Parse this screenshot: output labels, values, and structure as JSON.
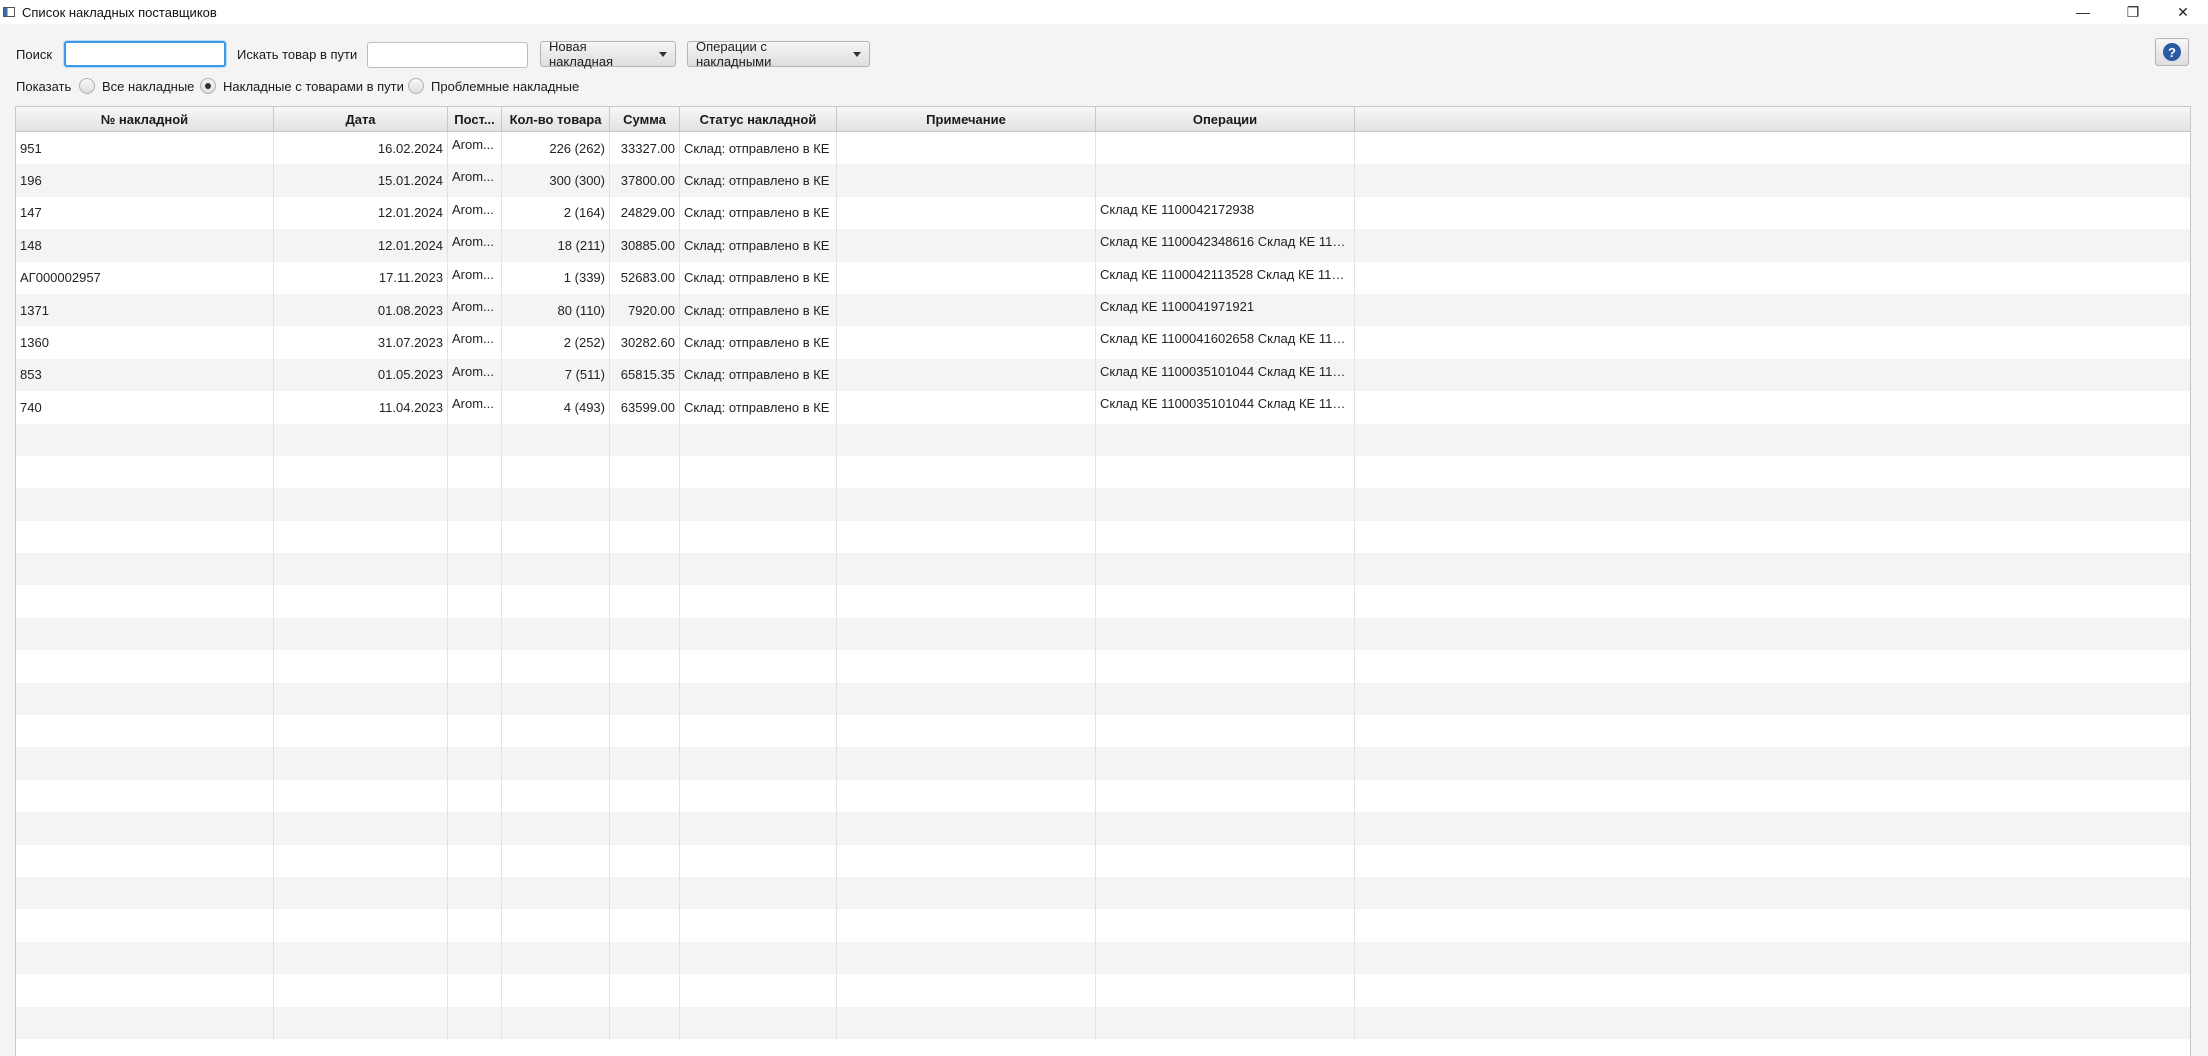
{
  "window": {
    "title": "Список накладных поставщиков",
    "controls": [
      "—",
      "❐",
      "✕"
    ]
  },
  "toolbar": {
    "search_label": "Поиск",
    "search_value": "",
    "transit_label": "Искать товар в пути",
    "transit_value": "",
    "new_invoice": "Новая накладная",
    "invoice_ops": "Операции с накладными",
    "help": "?"
  },
  "filter": {
    "show_label": "Показать",
    "options": [
      "Все накладные",
      "Накладные с товарами в пути",
      "Проблемные накладные"
    ],
    "selected": "Накладные с товарами в пути"
  },
  "table": {
    "columns": [
      "№ накладной",
      "Дата",
      "Пост...",
      "Кол-во товара",
      "Сумма",
      "Статус накладной",
      "Примечание",
      "Операции",
      ""
    ],
    "rows": [
      {
        "num": "951",
        "date": "16.02.2024",
        "supplier": "Arom...",
        "qty": "226 (262)",
        "sum": "33327.00",
        "status": "Склад: отправлено в КЕ",
        "note": "",
        "ops": ""
      },
      {
        "num": "196",
        "date": "15.01.2024",
        "supplier": "Arom...",
        "qty": "300 (300)",
        "sum": "37800.00",
        "status": "Склад: отправлено в КЕ",
        "note": "",
        "ops": ""
      },
      {
        "num": "147",
        "date": "12.01.2024",
        "supplier": "Arom...",
        "qty": "2 (164)",
        "sum": "24829.00",
        "status": "Склад: отправлено в КЕ",
        "note": "",
        "ops": "Склад КЕ 1100042172938"
      },
      {
        "num": "148",
        "date": "12.01.2024",
        "supplier": "Arom...",
        "qty": "18 (211)",
        "sum": "30885.00",
        "status": "Склад: отправлено в КЕ",
        "note": "",
        "ops": "Склад КЕ 1100042348616 Склад КЕ 11000..."
      },
      {
        "num": "АГ000002957",
        "date": "17.11.2023",
        "supplier": "Arom...",
        "qty": "1 (339)",
        "sum": "52683.00",
        "status": "Склад: отправлено в КЕ",
        "note": "",
        "ops": "Склад КЕ 1100042113528 Склад КЕ 11000..."
      },
      {
        "num": "1371",
        "date": "01.08.2023",
        "supplier": "Arom...",
        "qty": "80 (110)",
        "sum": "7920.00",
        "status": "Склад: отправлено в КЕ",
        "note": "",
        "ops": "Склад КЕ 1100041971921"
      },
      {
        "num": "1360",
        "date": "31.07.2023",
        "supplier": "Arom...",
        "qty": "2 (252)",
        "sum": "30282.60",
        "status": "Склад: отправлено в КЕ",
        "note": "",
        "ops": "Склад КЕ 1100041602658 Склад КЕ 11000..."
      },
      {
        "num": "853",
        "date": "01.05.2023",
        "supplier": "Arom...",
        "qty": "7 (511)",
        "sum": "65815.35",
        "status": "Склад: отправлено в КЕ",
        "note": "",
        "ops": "Склад КЕ 1100035101044 Склад КЕ 11000..."
      },
      {
        "num": "740",
        "date": "11.04.2023",
        "supplier": "Arom...",
        "qty": "4 (493)",
        "sum": "63599.00",
        "status": "Склад: отправлено в КЕ",
        "note": "",
        "ops": "Склад КЕ 1100035101044 Склад КЕ 11000..."
      }
    ]
  }
}
